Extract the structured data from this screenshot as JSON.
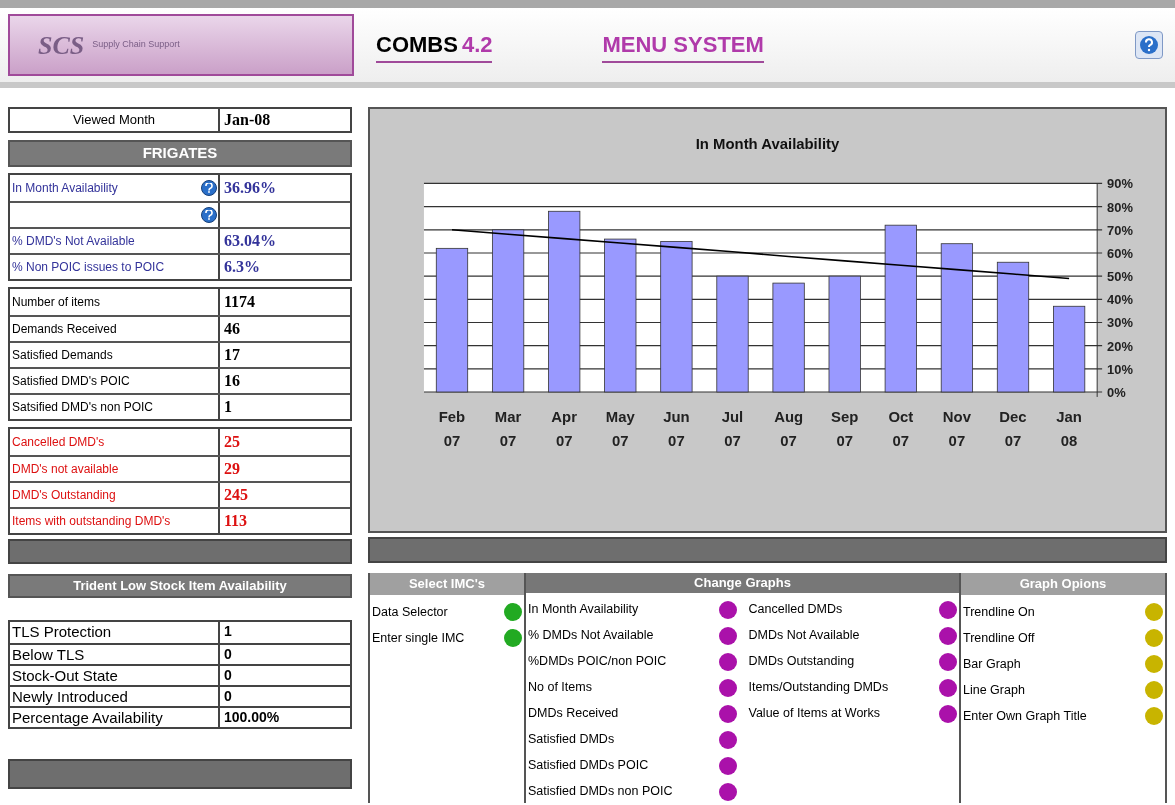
{
  "header": {
    "logo_main": "SCS",
    "logo_sub": "Supply Chain Support",
    "product": "COMBS",
    "version": "4.2",
    "title": "MENU SYSTEM"
  },
  "viewed": {
    "label": "Viewed Month",
    "value": "Jan-08"
  },
  "section_title": "FRIGATES",
  "groups": [
    {
      "color": "#33339a",
      "rows": [
        {
          "label": "In Month Availability",
          "value": "36.96%",
          "help": true
        },
        {
          "help": true
        },
        {
          "label": "% DMD's Not Available",
          "value": "63.04%",
          "help": false
        },
        {
          "label": "% Non POIC issues to POIC",
          "value": "6.3%",
          "help": false
        }
      ]
    },
    {
      "color": "#000000",
      "rows": [
        {
          "label": "Number of items",
          "value": "1174",
          "help": false
        },
        {
          "label": "Demands Received",
          "value": "46",
          "help": false
        },
        {
          "label": "Satisfied Demands",
          "value": "17",
          "help": false
        },
        {
          "label": "Satisfied DMD's POIC",
          "value": "16",
          "help": false
        },
        {
          "label": "Satsified DMD's non POIC",
          "value": "1",
          "help": false
        }
      ]
    },
    {
      "color": "#dd1111",
      "rows": [
        {
          "label": "Cancelled DMD's",
          "value": "25",
          "help": false
        },
        {
          "label": "DMD's not available",
          "value": "29",
          "help": false
        },
        {
          "label": "DMD's Outstanding",
          "value": "245",
          "help": false
        },
        {
          "label": "Items with outstanding DMD's",
          "value": "113",
          "help": false
        }
      ]
    }
  ],
  "tls": {
    "title": "Trident Low Stock Item Availability",
    "rows": [
      {
        "label": "TLS Protection",
        "value": "1"
      },
      {
        "label": "Below TLS",
        "value": "0"
      },
      {
        "label": "Stock-Out State",
        "value": "0"
      },
      {
        "label": "Newly Introduced",
        "value": "0"
      },
      {
        "label": "Percentage Availability",
        "value": "100.00%"
      }
    ]
  },
  "chart_data": {
    "type": "bar",
    "title": "In Month Availability",
    "categories": [
      "Feb 07",
      "Mar 07",
      "Apr 07",
      "May 07",
      "Jun 07",
      "Jul 07",
      "Aug 07",
      "Sep 07",
      "Oct 07",
      "Nov 07",
      "Dec 07",
      "Jan 08"
    ],
    "ylim": [
      0,
      90
    ],
    "yticks": [
      {
        "value": 0,
        "label": "0%"
      },
      {
        "value": 10,
        "label": "10%"
      },
      {
        "value": 20,
        "label": "20%"
      },
      {
        "value": 30,
        "label": "30%"
      },
      {
        "value": 40,
        "label": "40%"
      },
      {
        "value": 50,
        "label": "50%"
      },
      {
        "value": 60,
        "label": "60%"
      },
      {
        "value": 70,
        "label": "70%"
      },
      {
        "value": 80,
        "label": "80%"
      },
      {
        "value": 90,
        "label": "90%"
      }
    ],
    "grid": true,
    "series": [
      {
        "color": "#9999ff",
        "values": [
          62,
          70,
          78,
          66,
          65,
          50,
          47,
          50,
          72,
          64,
          56,
          37
        ]
      },
      {
        "type": "line",
        "color": "#000000",
        "values": [
          70,
          68.1,
          66.2,
          64.3,
          62.4,
          60.5,
          58.5,
          56.6,
          54.7,
          52.8,
          50.9,
          49
        ]
      }
    ]
  },
  "menu": [
    {
      "heading": "Select IMC's",
      "columns": [
        [
          {
            "label": "Data Selector",
            "color": "#22aa22"
          },
          {
            "label": "Enter single IMC",
            "color": "#22aa22"
          }
        ]
      ]
    },
    {
      "heading": "Change Graphs",
      "columns": [
        [
          {
            "label": "In Month Availability",
            "color": "#aa11aa"
          },
          {
            "label": "% DMDs Not Available",
            "color": "#aa11aa"
          },
          {
            "label": "%DMDs POIC/non POIC",
            "color": "#aa11aa"
          },
          {
            "label": "No of Items",
            "color": "#aa11aa"
          },
          {
            "label": "DMDs Received",
            "color": "#aa11aa"
          },
          {
            "label": "Satisfied DMDs",
            "color": "#aa11aa"
          },
          {
            "label": "Satisfied DMDs POIC",
            "color": "#aa11aa"
          },
          {
            "label": "Satisfied DMDs non POIC",
            "color": "#aa11aa"
          }
        ],
        [
          {
            "label": "Cancelled DMDs",
            "color": "#aa11aa"
          },
          {
            "label": "DMDs Not Available",
            "color": "#aa11aa"
          },
          {
            "label": "DMDs Outstanding",
            "color": "#aa11aa"
          },
          {
            "label": "Items/Outstanding DMDs",
            "color": "#aa11aa"
          },
          {
            "label": "Value of Items at Works",
            "color": "#aa11aa"
          }
        ]
      ]
    },
    {
      "heading": "Graph Opions",
      "columns": [
        [
          {
            "label": "Trendline On",
            "color": "#c8b400"
          },
          {
            "label": "Trendline Off",
            "color": "#c8b400"
          },
          {
            "label": "Bar Graph",
            "color": "#c8b400"
          },
          {
            "label": "Line Graph",
            "color": "#c8b400"
          },
          {
            "label": "Enter Own Graph Title",
            "color": "#c8b400"
          }
        ]
      ]
    }
  ]
}
